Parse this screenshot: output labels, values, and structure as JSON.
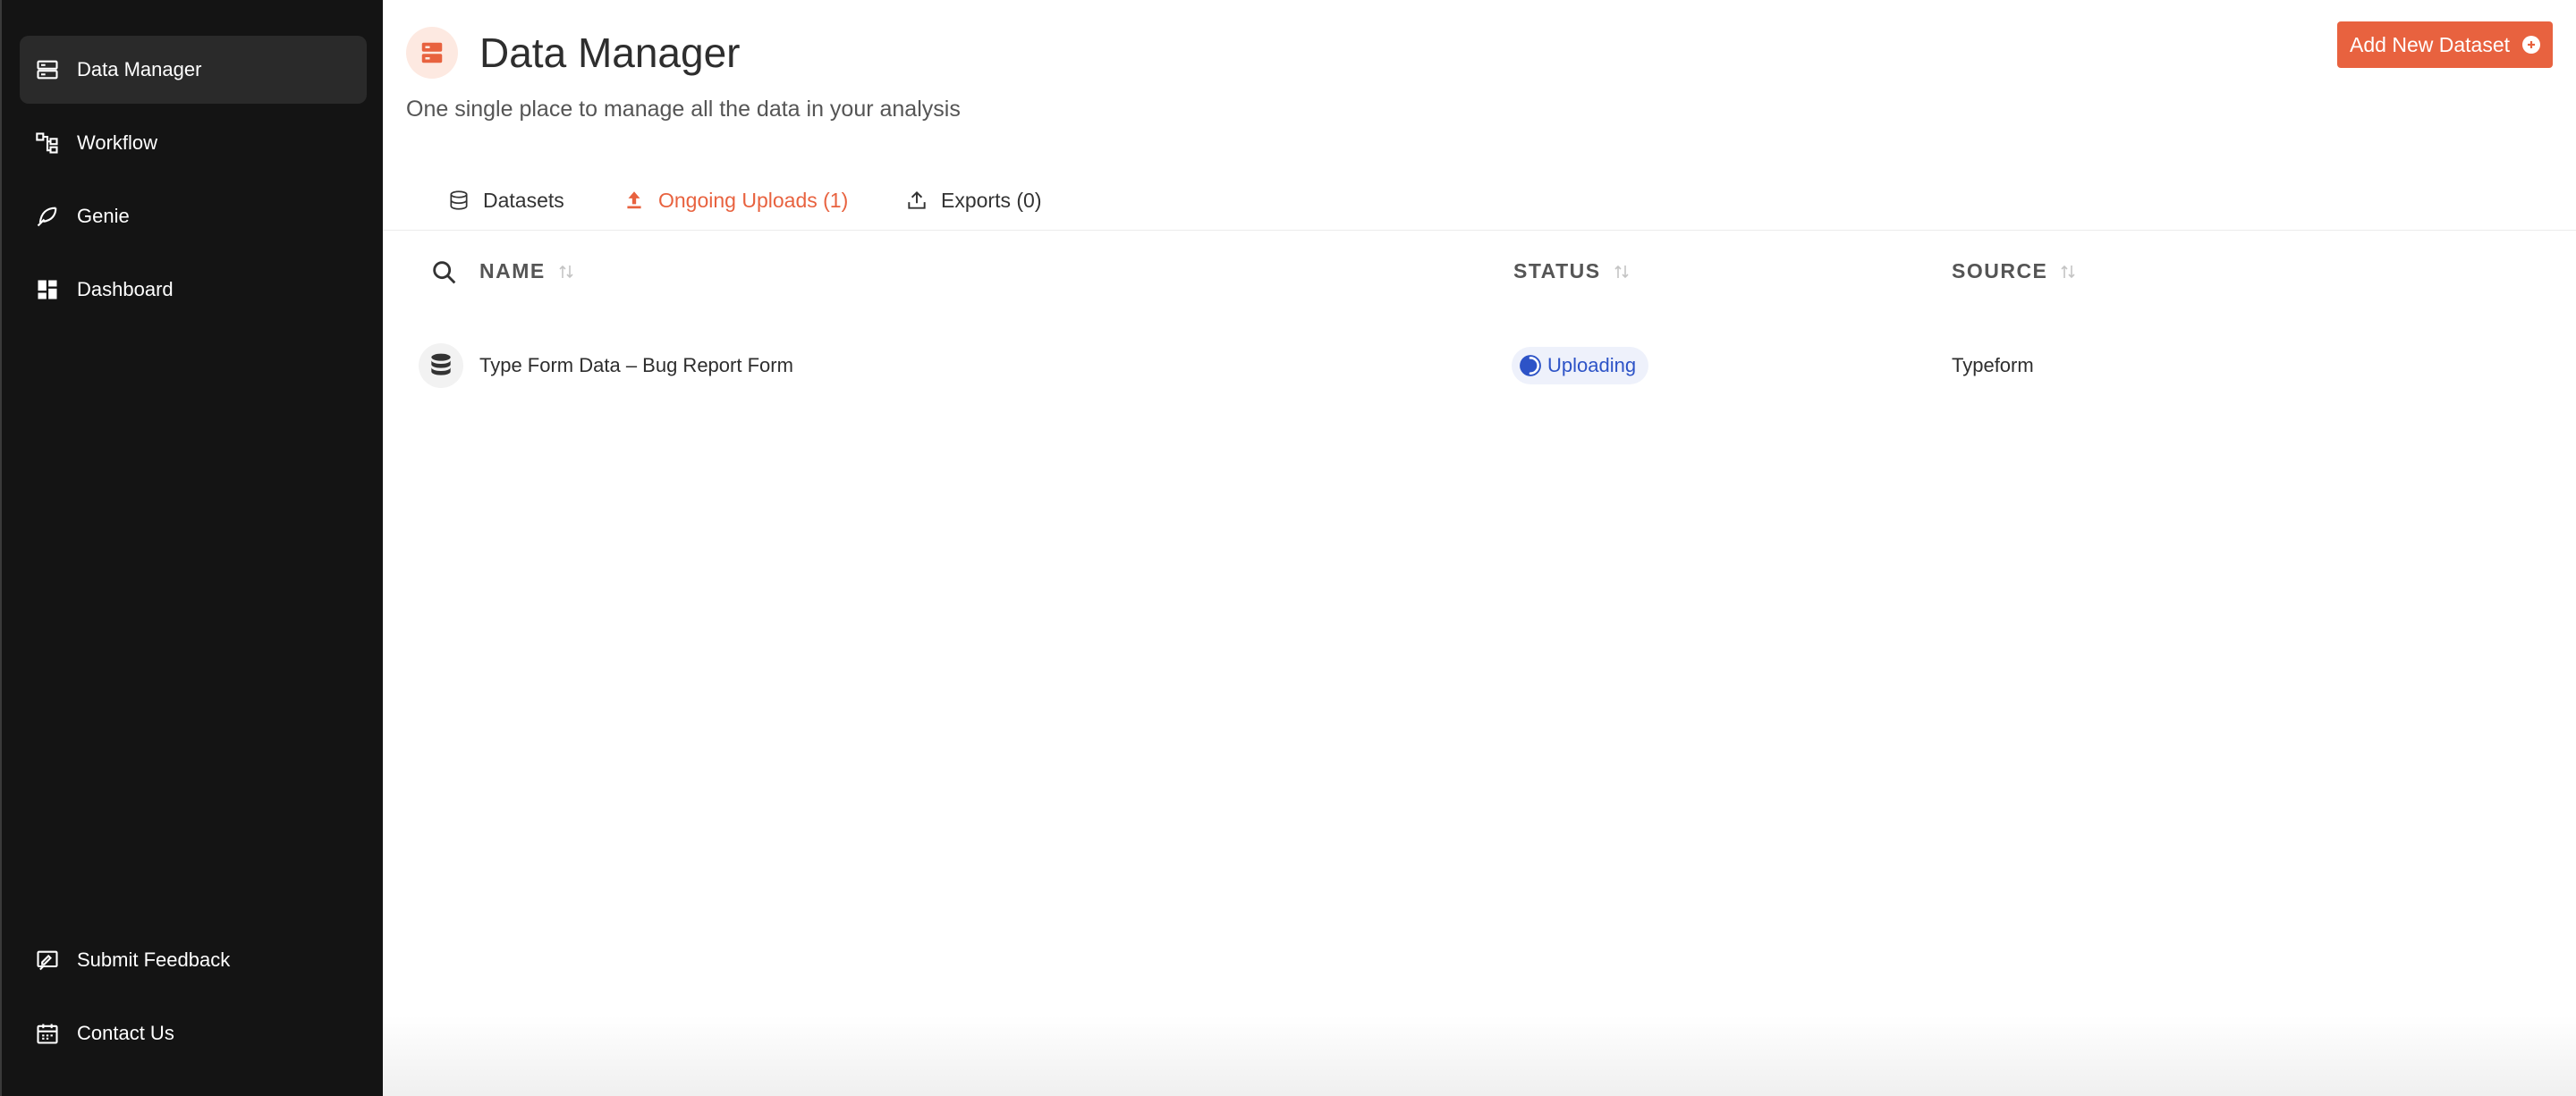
{
  "sidebar": {
    "items": [
      {
        "label": "Data Manager",
        "icon": "server-icon",
        "active": true
      },
      {
        "label": "Workflow",
        "icon": "workflow-icon",
        "active": false
      },
      {
        "label": "Genie",
        "icon": "feather-icon",
        "active": false
      },
      {
        "label": "Dashboard",
        "icon": "dashboard-icon",
        "active": false
      }
    ],
    "bottom_items": [
      {
        "label": "Submit Feedback",
        "icon": "feedback-icon"
      },
      {
        "label": "Contact Us",
        "icon": "calendar-icon"
      }
    ]
  },
  "header": {
    "title": "Data Manager",
    "subtitle": "One single place to manage all the data in your analysis",
    "add_button_label": "Add New Dataset"
  },
  "tabs": [
    {
      "label": "Datasets",
      "icon": "database-icon",
      "active": false
    },
    {
      "label": "Ongoing Uploads (1)",
      "icon": "upload-icon",
      "active": true
    },
    {
      "label": "Exports (0)",
      "icon": "export-icon",
      "active": false
    }
  ],
  "table": {
    "columns": [
      "NAME",
      "STATUS",
      "SOURCE"
    ],
    "rows": [
      {
        "name": "Type Form Data – Bug Report Form",
        "status": "Uploading",
        "source": "Typeform"
      }
    ]
  },
  "colors": {
    "accent": "#e8623f",
    "sidebar_bg": "#141414",
    "status_blue": "#2d53c7"
  }
}
